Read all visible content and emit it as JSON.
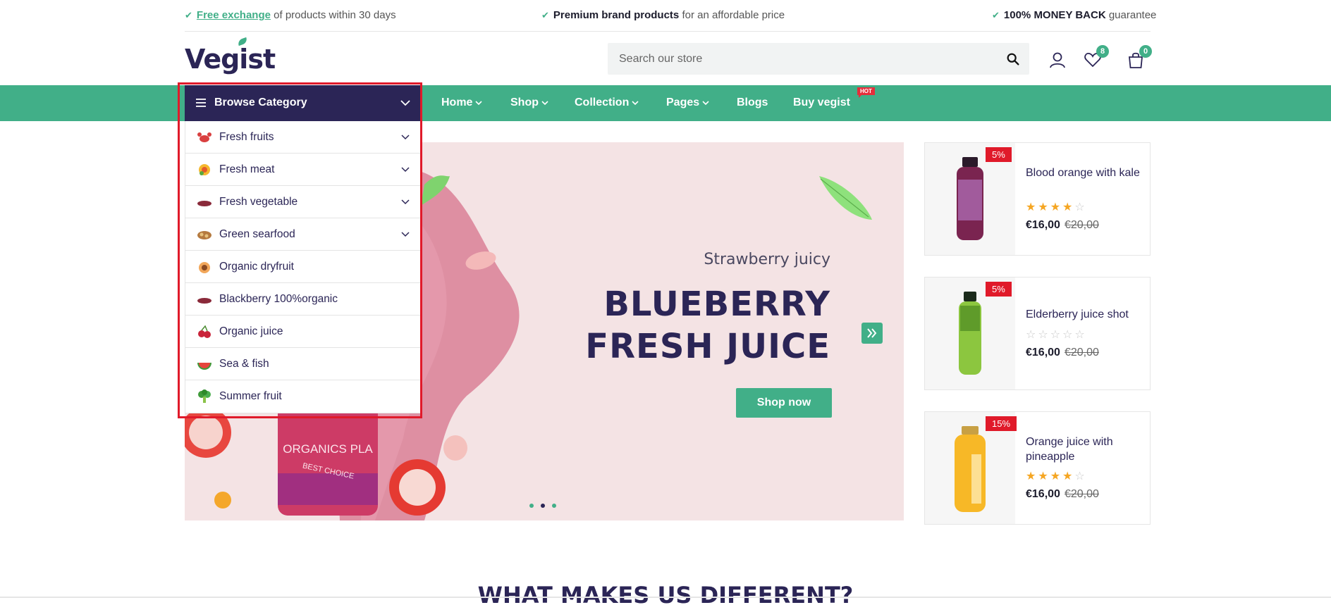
{
  "topbar": {
    "item1_link": "Free exchange",
    "item1_text": "of products within 30 days",
    "item2_bold": "Premium brand products",
    "item2_text": "for an affordable price",
    "item3_bold": "100% MONEY BACK",
    "item3_text": "guarantee"
  },
  "header": {
    "logo": "Vegist",
    "search_placeholder": "Search our store",
    "wishlist_count": "8",
    "cart_count": "0"
  },
  "nav": {
    "browse_label": "Browse Category",
    "items": [
      "Home",
      "Shop",
      "Collection",
      "Pages",
      "Blogs",
      "Buy vegist"
    ],
    "hot_badge": "HOT"
  },
  "categories": [
    {
      "label": "Fresh fruits",
      "icon": "crab-icon"
    },
    {
      "label": "Fresh meat",
      "icon": "flower-icon"
    },
    {
      "label": "Fresh vegetable",
      "icon": "berry-icon"
    },
    {
      "label": "Green searfood",
      "icon": "nuts-icon"
    },
    {
      "label": "Organic dryfruit",
      "icon": "peach-icon"
    },
    {
      "label": "Blackberry 100%organic",
      "icon": "berry-icon"
    },
    {
      "label": "Organic juice",
      "icon": "cherry-icon"
    },
    {
      "label": "Sea & fish",
      "icon": "watermelon-icon"
    },
    {
      "label": "Summer fruit",
      "icon": "broccoli-icon"
    }
  ],
  "hero": {
    "subtitle": "Strawberry juicy",
    "title_line1": "BLUEBERRY",
    "title_line2": "FRESH JUICE",
    "button": "Shop now",
    "bottle_label": "ORGANICS PLA",
    "bottle_sub": "BEST CHOICE",
    "active_slide": 2,
    "slide_count": 3
  },
  "products": [
    {
      "name": "Blood orange with kale",
      "discount": "5%",
      "rating": 4,
      "price": "€16,00",
      "old_price": "€20,00"
    },
    {
      "name": "Elderberry juice shot",
      "discount": "5%",
      "rating": 0,
      "price": "€16,00",
      "old_price": "€20,00"
    },
    {
      "name": "Orange juice with pineapple",
      "discount": "15%",
      "rating": 4,
      "price": "€16,00",
      "old_price": "€20,00"
    }
  ],
  "section_title": "WHAT MAKES US DIFFERENT?",
  "colors": {
    "accent": "#41af88",
    "dark": "#2b2556",
    "sale": "#e01a2a",
    "hero_bg": "#f4e3e4"
  }
}
